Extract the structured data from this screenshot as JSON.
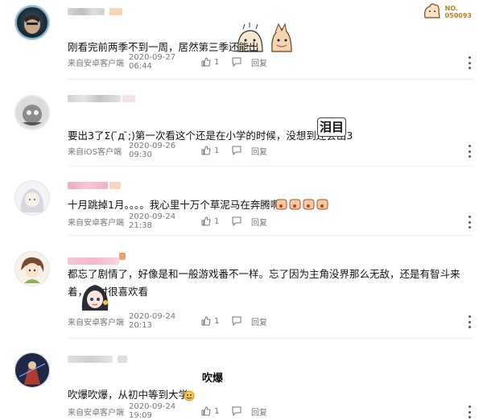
{
  "comments": [
    {
      "text": "刚看完前两季不到一周，居然第三季还能出",
      "source": "来自安卓客户端",
      "date": "2020-09-27 06:44",
      "likes": "1",
      "reply": "回复",
      "badge": "NO.\n050093"
    },
    {
      "text": "要出3了Σ( ̄д ̄;)第一次看这个还是在小学的时候，没想到还会出3",
      "source": "来自iOS客户端",
      "date": "2020-09-26 09:30",
      "likes": "1",
      "reply": "回复",
      "sticker_text": "泪目"
    },
    {
      "text": "十月跳掉1月。。。。我心里十万个草泥马在奔腾啊！",
      "source": "来自安卓客户端",
      "date": "2020-09-24 21:38",
      "likes": "1",
      "reply": "回复"
    },
    {
      "text": "都忘了剧情了，好像是和一般游戏番不一样。忘了因为主角没界那么无敌，还是有智斗来着，当时很喜欢看",
      "source": "来自安卓客户端",
      "date": "2020-09-24 20:13",
      "likes": "1",
      "reply": "回复"
    },
    {
      "text": "吹爆吹爆，从初中等到大学。",
      "source": "来自安卓客户端",
      "date": "2020-09-24 19:09",
      "likes": "1",
      "reply": "回复",
      "sticker_text": "吹爆"
    }
  ],
  "colors": {
    "meta_text": "#777777",
    "divider": "#eeeeee",
    "badge": "#b8841f"
  },
  "icons": [
    "thumb-up-icon",
    "reply-icon",
    "more-vertical-icon"
  ]
}
